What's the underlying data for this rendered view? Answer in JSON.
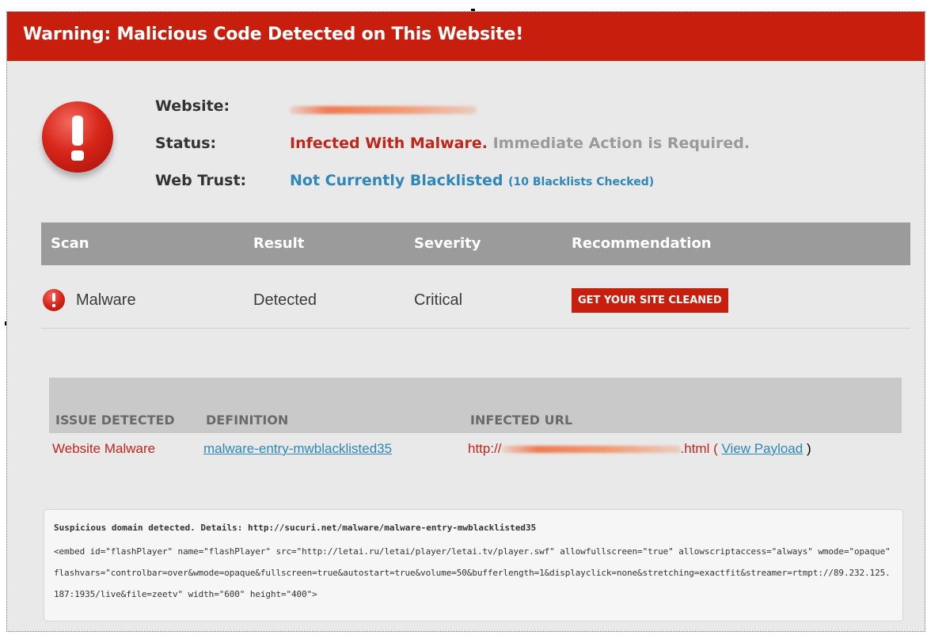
{
  "banner": {
    "title": "Warning: Malicious Code Detected on This Website!"
  },
  "site_info": {
    "website_label": "Website:",
    "status_label": "Status:",
    "status_value": "Infected With Malware.",
    "status_note": "Immediate Action is Required.",
    "trust_label": "Web Trust:",
    "trust_value": "Not Currently Blacklisted",
    "trust_note": "(10 Blacklists Checked)"
  },
  "scan_table": {
    "headers": [
      "Scan",
      "Result",
      "Severity",
      "Recommendation"
    ],
    "row": {
      "scan": "Malware",
      "result": "Detected",
      "severity": "Critical",
      "action_label": "GET YOUR SITE CLEANED"
    }
  },
  "issues": {
    "headers": [
      "ISSUE DETECTED",
      "DEFINITION",
      "INFECTED URL"
    ],
    "row": {
      "issue": "Website Malware",
      "definition": "malware-entry-mwblacklisted35",
      "url_prefix": "http://",
      "url_suffix": ".html",
      "paren_open": "(",
      "payload_link": "View Payload",
      "paren_close": ")"
    }
  },
  "details": {
    "summary": "Suspicious domain detected. Details: http://sucuri.net/malware/malware-entry-mwblacklisted35",
    "code": " <embed id=\"flashPlayer\" name=\"flashPlayer\" src=\"http://letai.ru/letai/player/letai.tv/player.swf\" allowfullscreen=\"true\" allowscriptaccess=\"always\" wmode=\"opaque\" flashvars=\"controlbar=over&wmode=opaque&fullscreen=true&autostart=true&volume=50&bufferlength=1&displayclick=none&stretching=exactfit&streamer=rtmpt://89.232.125.187:1935/live&file=zeetv\" width=\"600\" height=\"400\">"
  },
  "colors": {
    "banner": "#c81e0e",
    "danger": "#c0251a",
    "link": "#2f87b5",
    "table_header": "#9b9b9b"
  },
  "icons": [
    "alert-icon",
    "small-alert-icon"
  ]
}
